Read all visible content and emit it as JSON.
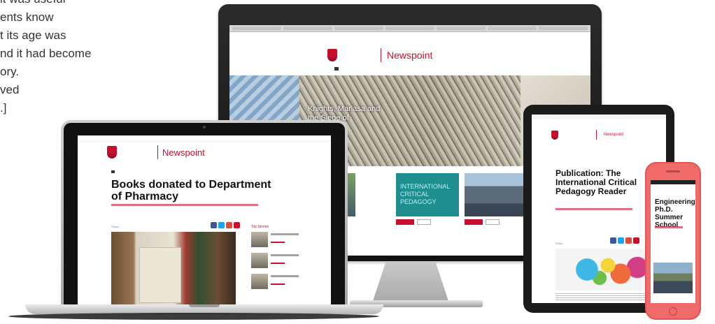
{
  "left_text": [
    "it was useful",
    "ents know",
    "t its age was",
    "nd it had become",
    "ory.",
    "ved",
    ".]"
  ],
  "brand": {
    "name": "Newspoint",
    "accent_color": "#c8102e"
  },
  "monitor": {
    "hero_caption": "Knights, Marlasa and the Siege of",
    "card_text": "INTERNATIONAL CRITICAL PEDAGOGY"
  },
  "laptop": {
    "article_title": "Books donated to Department of Pharmacy",
    "sidebar_heading": "Top Stories",
    "share_label": "Share"
  },
  "tablet": {
    "article_title": "Publication: The International Critical Pedagogy Reader",
    "share_label": "Share"
  },
  "phone": {
    "article_title": "Engineering Ph.D. Summer School"
  }
}
